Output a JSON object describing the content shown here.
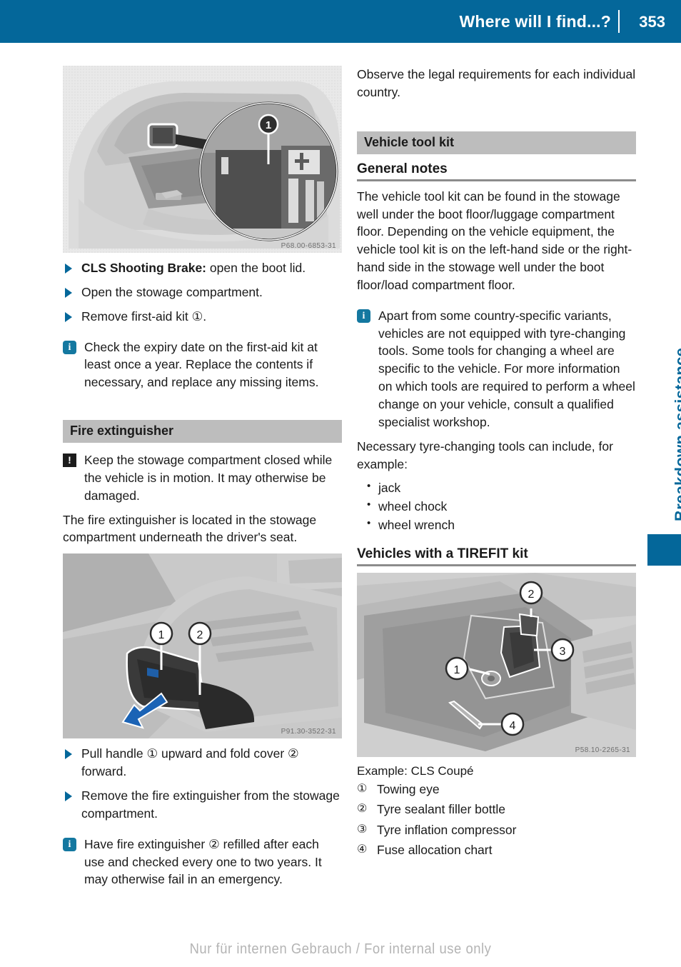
{
  "header": {
    "title": "Where will I find...?",
    "page_number": "353"
  },
  "side_tab": {
    "label": "Breakdown assistance",
    "color": "#04679a"
  },
  "footer": {
    "watermark": "Nur für internen Gebrauch / For internal use only"
  },
  "left_column": {
    "figure_first_aid": {
      "code": "P68.00-6853-31",
      "alt": "Boot with first-aid kit, magnified callout 1"
    },
    "steps": [
      {
        "lead": "CLS Shooting Brake:",
        "text": " open the boot lid."
      },
      {
        "lead": "",
        "text": "Open the stowage compartment."
      },
      {
        "lead": "",
        "text": "Remove first-aid kit ①."
      }
    ],
    "note_first_aid": "Check the expiry date on the first-aid kit at least once a year. Replace the contents if necessary, and replace any missing items.",
    "fire_extinguisher_heading": "Fire extinguisher",
    "warning_text": "Keep the stowage compartment closed while the vehicle is in motion. It may otherwise be damaged.",
    "location_text": "The fire extinguisher is located in the stowage compartment underneath the driver's seat.",
    "figure_seat": {
      "code": "P91.30-3522-31",
      "alt": "Driver's seat with handle 1 and cover 2, blue arrow"
    },
    "steps2": [
      {
        "lead": "",
        "text": "Pull handle ① upward and fold cover ② forward."
      },
      {
        "lead": "",
        "text": "Remove the fire extinguisher from the stowage compartment."
      }
    ],
    "note_refill": "Have fire extinguisher ② refilled after each use and checked every one to two years. It may otherwise fail in an emergency."
  },
  "right_column": {
    "intro_text": "Observe the legal requirements for each individual country.",
    "vehicle_tool_kit_heading": "Vehicle tool kit",
    "general_notes_heading": "General notes",
    "general_notes_text": "The vehicle tool kit can be found in the stowage well under the boot floor/luggage compartment floor. Depending on the vehicle equipment, the vehicle tool kit is on the left-hand side or the right-hand side in the stowage well under the boot floor/load compartment floor.",
    "note_tools": "Apart from some country-specific variants, vehicles are not equipped with tyre-changing tools. Some tools for changing a wheel are specific to the vehicle. For more information on which tools are required to perform a wheel change on your vehicle, consult a qualified specialist workshop.",
    "tools_lead": "Necessary tyre-changing tools can include, for example:",
    "tools_list": [
      "jack",
      "wheel chock",
      "wheel wrench"
    ],
    "tirefit_heading": "Vehicles with a TIREFIT kit",
    "figure_tirefit": {
      "code": "P58.10-2265-31",
      "alt": "Boot stowage well with callouts 1 to 4"
    },
    "legend_caption": "Example: CLS Coupé",
    "legend": [
      {
        "num": "①",
        "label": "Towing eye"
      },
      {
        "num": "②",
        "label": "Tyre sealant filler bottle"
      },
      {
        "num": "③",
        "label": "Tyre inflation compressor"
      },
      {
        "num": "④",
        "label": "Fuse allocation chart"
      }
    ]
  },
  "icons": {
    "info": "i",
    "warning": "!",
    "step_marker": "triangle-right-icon"
  }
}
